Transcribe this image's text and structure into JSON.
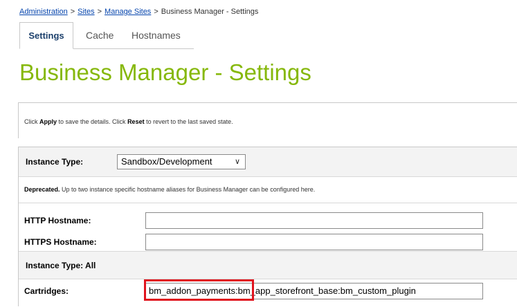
{
  "breadcrumb": {
    "administration": "Administration",
    "sites": "Sites",
    "manage_sites": "Manage Sites",
    "current": "Business Manager - Settings",
    "separator": ">"
  },
  "tabs": [
    {
      "label": "Settings",
      "active": true
    },
    {
      "label": "Cache",
      "active": false
    },
    {
      "label": "Hostnames",
      "active": false
    }
  ],
  "page_title": "Business Manager - Settings",
  "info": {
    "p1": "Click ",
    "apply": "Apply",
    "p2": " to save the details. Click ",
    "reset": "Reset",
    "p3": " to revert to the last saved state."
  },
  "form": {
    "instance_type_label": "Instance Type:",
    "instance_type_value": "Sandbox/Development",
    "deprecated_bold": "Deprecated.",
    "deprecated_text": " Up to two instance specific hostname aliases for Business Manager can be configured here.",
    "http_label": "HTTP Hostname:",
    "http_value": "",
    "https_label": "HTTPS Hostname:",
    "https_value": "",
    "instance_all_label": "Instance Type: All",
    "cartridges_label": "Cartridges:",
    "cartridges_value": "bm_addon_payments:bm_app_storefront_base:bm_custom_plugin"
  },
  "colors": {
    "title": "#86b80b",
    "link": "#0645ad",
    "highlight": "#e0141e"
  },
  "icons": {
    "select_chevron": "chevron-down-icon"
  }
}
